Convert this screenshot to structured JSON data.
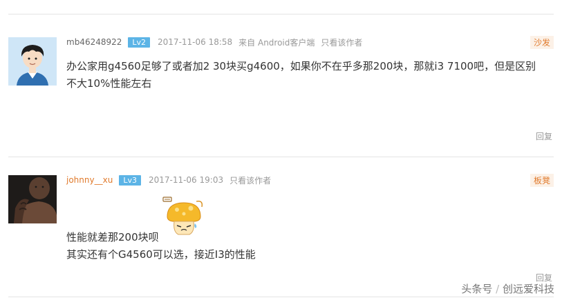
{
  "posts": [
    {
      "username": "mb46248922",
      "level": "Lv2",
      "time": "2017-11-06 18:58",
      "source": "来自 Android客户端",
      "only_author": "只看该作者",
      "floor": "沙发",
      "lines": [
        "办公家用g4560足够了或者加2 30块买g4600，如果你不在乎多那200块，那就i3 7100吧，但是区别",
        "不大10%性能左右"
      ],
      "reply": "回复"
    },
    {
      "username": "johnny__xu",
      "level": "Lv3",
      "time": "2017-11-06 19:03",
      "only_author": "只看该作者",
      "floor": "板凳",
      "lines": [
        "性能就差那200块呗",
        "其实还有个G4560可以选，接近I3的性能"
      ],
      "reply": "回复"
    }
  ],
  "watermark": {
    "prefix": "头条号",
    "slash": "/",
    "name": "创远爱科技"
  },
  "colors": {
    "accent_orange": "#e07a2c",
    "level_badge": "#5cb4e6",
    "divider": "#e4e4e4"
  }
}
